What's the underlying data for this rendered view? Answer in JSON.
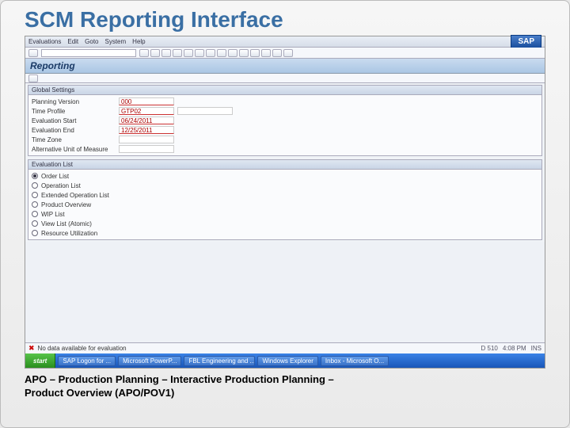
{
  "slide": {
    "title": "SCM Reporting Interface",
    "breadcrumb_line1": "APO – Production Planning – Interactive Production Planning –",
    "breadcrumb_line2": "Product Overview (APO/POV1)"
  },
  "menubar": {
    "items": [
      "Evaluations",
      "Edit",
      "Goto",
      "System",
      "Help"
    ]
  },
  "screen": {
    "title": "Reporting"
  },
  "global_settings": {
    "header": "Global Settings",
    "fields": [
      {
        "label": "Planning Version",
        "value": "000",
        "required": true
      },
      {
        "label": "Time Profile",
        "value": "GTP02",
        "required": true
      },
      {
        "label": "Evaluation Start",
        "value": "06/24/2011",
        "required": true
      },
      {
        "label": "Evaluation End",
        "value": "12/25/2011",
        "required": true
      },
      {
        "label": "Time Zone",
        "value": "",
        "required": false
      },
      {
        "label": "Alternative Unit of Measure",
        "value": "",
        "required": false
      }
    ]
  },
  "evaluation_list": {
    "header": "Evaluation List",
    "options": [
      {
        "label": "Order List",
        "selected": true
      },
      {
        "label": "Operation List",
        "selected": false
      },
      {
        "label": "Extended Operation List",
        "selected": false
      },
      {
        "label": "Product Overview",
        "selected": false
      },
      {
        "label": "WIP List",
        "selected": false
      },
      {
        "label": "View List (Atomic)",
        "selected": false
      },
      {
        "label": "Resource Utilization",
        "selected": false
      }
    ]
  },
  "statusbar": {
    "message": "No data available for evaluation",
    "right": [
      "D   510",
      "4:08 PM",
      "INS"
    ]
  },
  "taskbar": {
    "start": "start",
    "tasks": [
      "SAP Logon for ...",
      "Microsoft PowerP...",
      "FBL Engineering and ...",
      "Windows Explorer",
      "Inbox - Microsoft O..."
    ]
  }
}
